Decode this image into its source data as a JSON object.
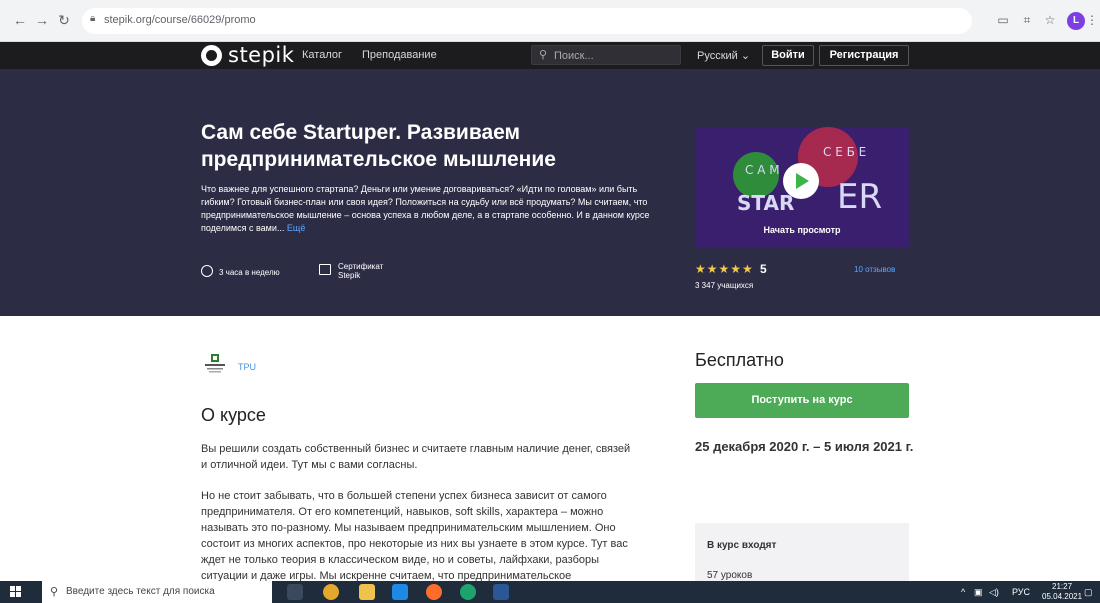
{
  "browser": {
    "url": "stepik.org/course/66029/promo",
    "profile_initial": "L"
  },
  "topnav": {
    "logo": "stepik",
    "catalog": "Каталог",
    "teaching": "Преподавание",
    "search_placeholder": "Поиск...",
    "language": "Русский",
    "login": "Войти",
    "register": "Регистрация"
  },
  "hero": {
    "title": "Сам себе Startuper. Развиваем предпринимательское мышление",
    "description": "Что важнее для успешного стартапа? Деньги или умение договариваться? «Идти по головам» или быть гибким? Готовый бизнес-план или своя идея? Положиться на судьбу или всё продумать? Мы считаем, что предпринимательское мышление – основа успеха в любом деле, а в стартапе особенно. И в данном курсе поделимся с вами...",
    "more": "Ещё",
    "workload": "3 часа в неделю",
    "certificate_line1": "Сертификат",
    "certificate_line2": "Stepik",
    "promo_label": "Начать просмотр",
    "stars": "★★★★★",
    "rating": "5",
    "students": "3 347 учащихся",
    "reviews": "10 отзывов"
  },
  "about": {
    "org": "TPU",
    "title": "О курсе",
    "paragraph1": "Вы решили создать собственный бизнес и считаете главным наличие денег, связей и отличной идеи. Тут мы с вами согласны.",
    "paragraph2": "Но не стоит забывать, что в большей степени успех бизнеса зависит от самого предпринимателя. От его компетенций, навыков, soft skills, характера – можно называть это по-разному. Мы называем предпринимательским мышлением. Оно состоит из многих аспектов, про некоторые из них вы узнаете в этом курсе. Тут вас ждет не только теория в классическом виде, но и советы, лайфхаки, разборы ситуации и даже игры. Мы искренне считаем, что предпринимательское"
  },
  "sidebar": {
    "price": "Бесплатно",
    "enroll": "Поступить на курс",
    "dates": "25 декабря 2020 г. – 5 июля 2021 г.",
    "includes_title": "В курс входят",
    "lessons": "57 уроков"
  },
  "taskbar": {
    "search_placeholder": "Введите здесь текст для поиска",
    "lang": "РУС",
    "time": "21:27",
    "date": "05.04.2021"
  }
}
